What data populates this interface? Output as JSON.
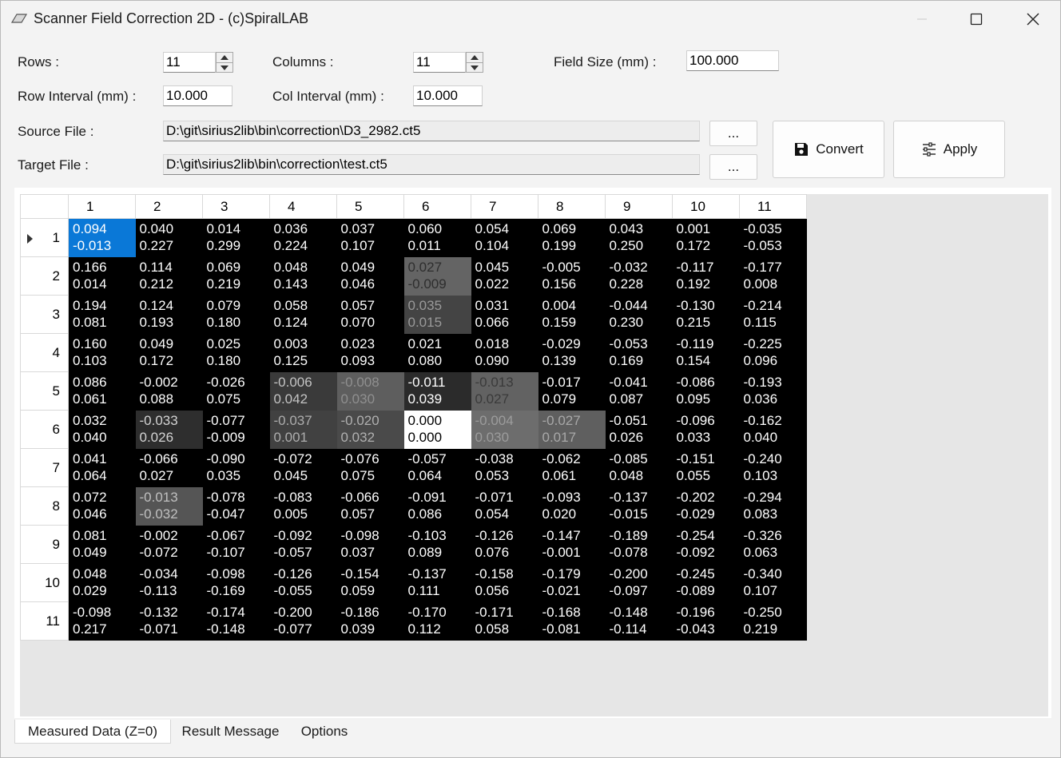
{
  "window": {
    "title": "Scanner Field Correction 2D - (c)SpiralLAB"
  },
  "form": {
    "rows_label": "Rows :",
    "rows_value": "11",
    "columns_label": "Columns :",
    "columns_value": "11",
    "field_size_label": "Field Size (mm) :",
    "field_size_value": "100.000",
    "row_interval_label": "Row Interval (mm) :",
    "row_interval_value": "10.000",
    "col_interval_label": "Col Interval (mm) :",
    "col_interval_value": "10.000",
    "source_file_label": "Source File :",
    "source_file_value": "D:\\git\\sirius2lib\\bin\\correction\\D3_2982.ct5",
    "target_file_label": "Target File :",
    "target_file_value": "D:\\git\\sirius2lib\\bin\\correction\\test.ct5",
    "browse_label": "..."
  },
  "buttons": {
    "convert_label": "Convert",
    "apply_label": "Apply"
  },
  "grid": {
    "column_headers": [
      "1",
      "2",
      "3",
      "4",
      "5",
      "6",
      "7",
      "8",
      "9",
      "10",
      "11"
    ],
    "row_headers": [
      "1",
      "2",
      "3",
      "4",
      "5",
      "6",
      "7",
      "8",
      "9",
      "10",
      "11"
    ],
    "rows": [
      [
        [
          "0.094",
          "-0.013"
        ],
        [
          "0.040",
          "0.227"
        ],
        [
          "0.014",
          "0.299"
        ],
        [
          "0.036",
          "0.224"
        ],
        [
          "0.037",
          "0.107"
        ],
        [
          "0.060",
          "0.011"
        ],
        [
          "0.054",
          "0.104"
        ],
        [
          "0.069",
          "0.199"
        ],
        [
          "0.043",
          "0.250"
        ],
        [
          "0.001",
          "0.172"
        ],
        [
          "-0.035",
          "-0.053"
        ]
      ],
      [
        [
          "0.166",
          "0.014"
        ],
        [
          "0.114",
          "0.212"
        ],
        [
          "0.069",
          "0.219"
        ],
        [
          "0.048",
          "0.143"
        ],
        [
          "0.049",
          "0.046"
        ],
        [
          "0.027",
          "-0.009"
        ],
        [
          "0.045",
          "0.022"
        ],
        [
          "-0.005",
          "0.156"
        ],
        [
          "-0.032",
          "0.228"
        ],
        [
          "-0.117",
          "0.192"
        ],
        [
          "-0.177",
          "0.008"
        ]
      ],
      [
        [
          "0.194",
          "0.081"
        ],
        [
          "0.124",
          "0.193"
        ],
        [
          "0.079",
          "0.180"
        ],
        [
          "0.058",
          "0.124"
        ],
        [
          "0.057",
          "0.070"
        ],
        [
          "0.035",
          "0.015"
        ],
        [
          "0.031",
          "0.066"
        ],
        [
          "0.004",
          "0.159"
        ],
        [
          "-0.044",
          "0.230"
        ],
        [
          "-0.130",
          "0.215"
        ],
        [
          "-0.214",
          "0.115"
        ]
      ],
      [
        [
          "0.160",
          "0.103"
        ],
        [
          "0.049",
          "0.172"
        ],
        [
          "0.025",
          "0.180"
        ],
        [
          "0.003",
          "0.125"
        ],
        [
          "0.023",
          "0.093"
        ],
        [
          "0.021",
          "0.080"
        ],
        [
          "0.018",
          "0.090"
        ],
        [
          "-0.029",
          "0.139"
        ],
        [
          "-0.053",
          "0.169"
        ],
        [
          "-0.119",
          "0.154"
        ],
        [
          "-0.225",
          "0.096"
        ]
      ],
      [
        [
          "0.086",
          "0.061"
        ],
        [
          "-0.002",
          "0.088"
        ],
        [
          "-0.026",
          "0.075"
        ],
        [
          "-0.006",
          "0.042"
        ],
        [
          "-0.008",
          "0.030"
        ],
        [
          "-0.011",
          "0.039"
        ],
        [
          "-0.013",
          "0.027"
        ],
        [
          "-0.017",
          "0.079"
        ],
        [
          "-0.041",
          "0.087"
        ],
        [
          "-0.086",
          "0.095"
        ],
        [
          "-0.193",
          "0.036"
        ]
      ],
      [
        [
          "0.032",
          "0.040"
        ],
        [
          "-0.033",
          "0.026"
        ],
        [
          "-0.077",
          "-0.009"
        ],
        [
          "-0.037",
          "0.001"
        ],
        [
          "-0.020",
          "0.032"
        ],
        [
          "0.000",
          "0.000"
        ],
        [
          "-0.004",
          "0.030"
        ],
        [
          "-0.027",
          "0.017"
        ],
        [
          "-0.051",
          "0.026"
        ],
        [
          "-0.096",
          "0.033"
        ],
        [
          "-0.162",
          "0.040"
        ]
      ],
      [
        [
          "0.041",
          "0.064"
        ],
        [
          "-0.066",
          "0.027"
        ],
        [
          "-0.090",
          "0.035"
        ],
        [
          "-0.072",
          "0.045"
        ],
        [
          "-0.076",
          "0.075"
        ],
        [
          "-0.057",
          "0.064"
        ],
        [
          "-0.038",
          "0.053"
        ],
        [
          "-0.062",
          "0.061"
        ],
        [
          "-0.085",
          "0.048"
        ],
        [
          "-0.151",
          "0.055"
        ],
        [
          "-0.240",
          "0.103"
        ]
      ],
      [
        [
          "0.072",
          "0.046"
        ],
        [
          "-0.013",
          "-0.032"
        ],
        [
          "-0.078",
          "-0.047"
        ],
        [
          "-0.083",
          "0.005"
        ],
        [
          "-0.066",
          "0.057"
        ],
        [
          "-0.091",
          "0.086"
        ],
        [
          "-0.071",
          "0.054"
        ],
        [
          "-0.093",
          "0.020"
        ],
        [
          "-0.137",
          "-0.015"
        ],
        [
          "-0.202",
          "-0.029"
        ],
        [
          "-0.294",
          "0.083"
        ]
      ],
      [
        [
          "0.081",
          "0.049"
        ],
        [
          "-0.002",
          "-0.072"
        ],
        [
          "-0.067",
          "-0.107"
        ],
        [
          "-0.092",
          "-0.057"
        ],
        [
          "-0.098",
          "0.037"
        ],
        [
          "-0.103",
          "0.089"
        ],
        [
          "-0.126",
          "0.076"
        ],
        [
          "-0.147",
          "-0.001"
        ],
        [
          "-0.189",
          "-0.078"
        ],
        [
          "-0.254",
          "-0.092"
        ],
        [
          "-0.326",
          "0.063"
        ]
      ],
      [
        [
          "0.048",
          "0.029"
        ],
        [
          "-0.034",
          "-0.113"
        ],
        [
          "-0.098",
          "-0.169"
        ],
        [
          "-0.126",
          "-0.055"
        ],
        [
          "-0.154",
          "0.059"
        ],
        [
          "-0.137",
          "0.111"
        ],
        [
          "-0.158",
          "0.056"
        ],
        [
          "-0.179",
          "-0.021"
        ],
        [
          "-0.200",
          "-0.097"
        ],
        [
          "-0.245",
          "-0.089"
        ],
        [
          "-0.340",
          "0.107"
        ]
      ],
      [
        [
          "-0.098",
          "0.217"
        ],
        [
          "-0.132",
          "-0.071"
        ],
        [
          "-0.174",
          "-0.148"
        ],
        [
          "-0.200",
          "-0.077"
        ],
        [
          "-0.186",
          "0.039"
        ],
        [
          "-0.170",
          "0.112"
        ],
        [
          "-0.171",
          "0.058"
        ],
        [
          "-0.168",
          "-0.081"
        ],
        [
          "-0.148",
          "-0.114"
        ],
        [
          "-0.196",
          "-0.043"
        ],
        [
          "-0.250",
          "0.219"
        ]
      ]
    ],
    "cell_colors": {
      "0,0": {
        "bg": "#0a78d7",
        "fg": "#ffffff"
      },
      "1,5": {
        "bg": "#646464",
        "fg": "#2e2e2e"
      },
      "2,5": {
        "bg": "#444444",
        "fg": "#9a9a9a"
      },
      "4,3": {
        "bg": "#3a3a3a",
        "fg": "#c4c4c4"
      },
      "4,4": {
        "bg": "#5e5e5e",
        "fg": "#8f8f8f"
      },
      "4,5": {
        "bg": "#2b2b2b",
        "fg": "#ffffff"
      },
      "4,6": {
        "bg": "#626262",
        "fg": "#3a3a3a"
      },
      "5,1": {
        "bg": "#2e2e2e",
        "fg": "#d4d4d4"
      },
      "5,3": {
        "bg": "#414141",
        "fg": "#adadad"
      },
      "5,4": {
        "bg": "#4a4a4a",
        "fg": "#b0b0b0"
      },
      "5,5": {
        "bg": "#ffffff",
        "fg": "#000000"
      },
      "5,6": {
        "bg": "#6d6d6d",
        "fg": "#9c9c9c"
      },
      "5,7": {
        "bg": "#5f5f5f",
        "fg": "#a8a8a8"
      },
      "7,1": {
        "bg": "#555555",
        "fg": "#c0c0c0"
      }
    },
    "selected_row": "1"
  },
  "tabs": [
    "Measured Data (Z=0)",
    "Result Message",
    "Options"
  ]
}
